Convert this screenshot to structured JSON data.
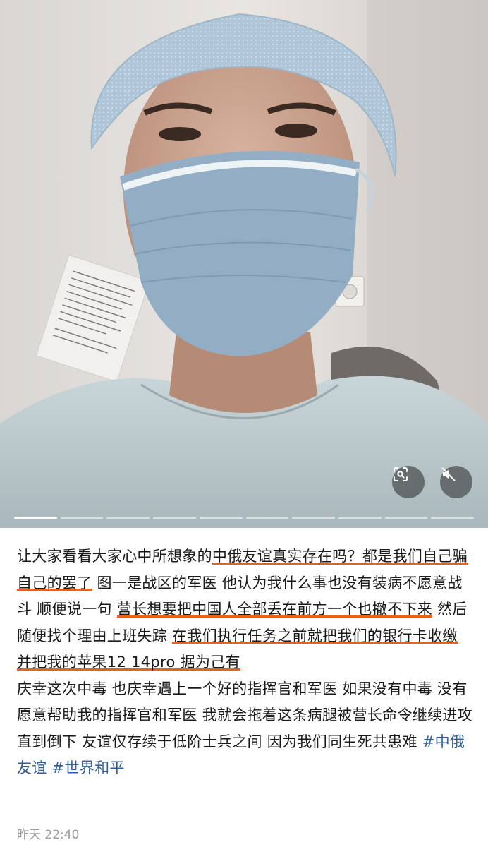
{
  "media": {
    "photo_description": "selfie of a person wearing a surgical cap, face mask and protective gown",
    "slide_count": 10,
    "active_slide": 1,
    "icons": [
      "scan-icon",
      "muted-speaker-icon"
    ]
  },
  "post": {
    "text_a": "让大家看看大家心中所想象的",
    "hl_1": "中俄友谊真实存在吗？都是我们自己骗自己的罢了",
    "text_b": " 图一是战区的军医 他认为我什么事也没有装病不愿意战斗 顺便说一句 ",
    "hl_2": "营长想要把中国人全部丢在前方一个也撤不下来",
    "text_c": " 然后随便找个理由上班失踪 ",
    "hl_3": "在我们执行任务之前就把我们的银行卡收缴 并把我的苹果12 14pro 据为己有",
    "para_2": "庆幸这次中毒 也庆幸遇上一个好的指挥官和军医 如果没有中毒 没有愿意帮助我的指挥官和军医 我就会拖着这条病腿被营长命令继续进攻 直到倒下 友谊仅存续于低阶士兵之间 因为我们同生死共患难 ",
    "tag_1": "#中俄友谊",
    "tag_2": "#世界和平",
    "timestamp": "昨天 22:40"
  },
  "colors": {
    "highlight_underline": "#e8621a",
    "hashtag": "#2f5d9e",
    "timestamp": "#9a9a9a"
  }
}
